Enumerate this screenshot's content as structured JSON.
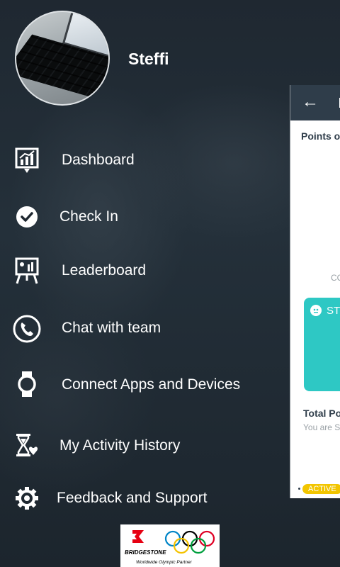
{
  "profile": {
    "name": "Steffi"
  },
  "menu": [
    {
      "label": "Dashboard",
      "icon": "dashboard-chart-icon"
    },
    {
      "label": "Check In",
      "icon": "checkmark-circle-icon"
    },
    {
      "label": "Leaderboard",
      "icon": "leaderboard-easel-icon"
    },
    {
      "label": "Chat with team",
      "icon": "phone-circle-icon"
    },
    {
      "label": "Connect Apps and Devices",
      "icon": "smartwatch-icon"
    },
    {
      "label": "My Activity History",
      "icon": "hourglass-heart-icon"
    },
    {
      "label": "Feedback and Support",
      "icon": "gear-icon"
    }
  ],
  "preview": {
    "back_symbol": "←",
    "points_label": "Points o",
    "co_label": "CO",
    "card_text": "ST",
    "total_label": "Total Po",
    "you_are_text": "You are S",
    "badge": "ACTIVE"
  },
  "sponsor": {
    "brand": "BRIDGESTONE",
    "tagline": "Worldwide Olympic Partner"
  },
  "colors": {
    "toolbar": "#2f3d4a",
    "card": "#2ec8c4",
    "badge": "#f2c500",
    "rings": [
      "#0085c7",
      "#f4c300",
      "#000000",
      "#009f3d",
      "#df0024"
    ],
    "bridgestone_red": "#e60012"
  }
}
